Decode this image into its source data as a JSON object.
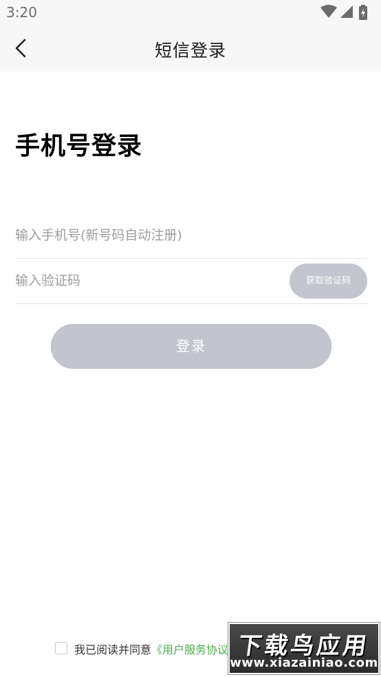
{
  "status_bar": {
    "time": "3:20",
    "icons": [
      "wifi-icon",
      "cell-signal-icon",
      "battery-charging-icon"
    ]
  },
  "nav": {
    "title": "短信登录",
    "back_icon": "chevron-left-icon"
  },
  "main": {
    "heading": "手机号登录",
    "phone_input": {
      "placeholder": "输入手机号(新号码自动注册)",
      "value": ""
    },
    "code_input": {
      "placeholder": "输入验证码",
      "value": ""
    },
    "get_code_label": "获取验证码",
    "login_label": "登录"
  },
  "agreement": {
    "checked": false,
    "prefix": "我已阅读并同意",
    "link": "《用户服务协议"
  },
  "watermark": {
    "title": "下载鸟应用",
    "url": "www.xiazainiao.com"
  },
  "colors": {
    "bar_background": "#f7f7f7",
    "button_disabled": "#c2c5ce",
    "link": "#4caf50"
  }
}
